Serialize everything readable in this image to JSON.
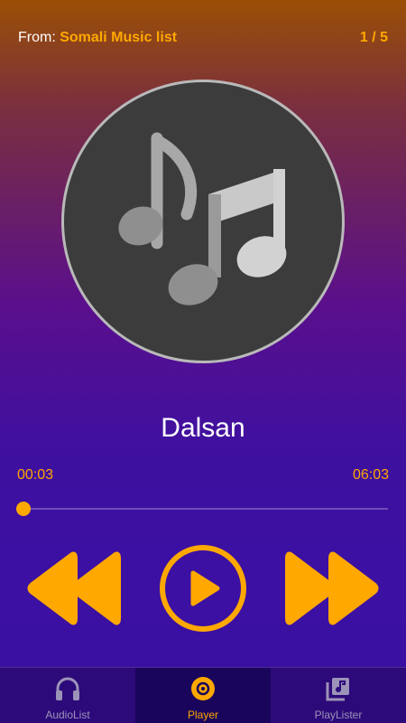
{
  "header": {
    "from_label": "From:",
    "playlist_name": "Somali Music list",
    "track_counter": "1 / 5"
  },
  "artwork": {
    "icon": "music-notes-icon"
  },
  "song": {
    "title": "Dalsan"
  },
  "progress": {
    "elapsed": "00:03",
    "total": "06:03",
    "fraction": 0.008
  },
  "controls": {
    "rewind_icon": "rewind-icon",
    "play_icon": "play-icon",
    "forward_icon": "fast-forward-icon"
  },
  "nav": {
    "items": [
      {
        "label": "AudioList",
        "icon": "headphones-icon",
        "active": false
      },
      {
        "label": "Player",
        "icon": "disc-icon",
        "active": true
      },
      {
        "label": "PlayLister",
        "icon": "playlist-icon",
        "active": false
      }
    ]
  },
  "colors": {
    "accent": "#ffa800",
    "nav_background": "#2d0a7a",
    "nav_active_background": "#1a055c",
    "artwork_background": "#3c3c3c"
  }
}
